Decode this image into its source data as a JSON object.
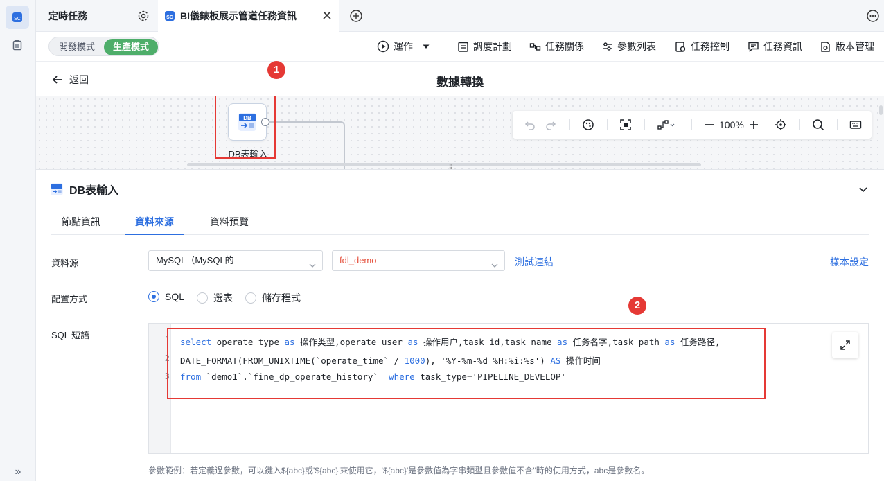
{
  "tabs": [
    {
      "label": "定時任務",
      "icon": "gear-icon"
    },
    {
      "label": "BI儀錶板展示管道任務資訊",
      "icon": "close-icon"
    }
  ],
  "mode": {
    "dev_label": "開發模式",
    "prod_label": "生產模式",
    "active": "prod"
  },
  "toolbar": {
    "run": "運作",
    "schedule": "調度計劃",
    "relation": "任務關係",
    "params": "參數列表",
    "control": "任務控制",
    "info": "任務資訊",
    "version": "版本管理"
  },
  "subhead": {
    "back": "返回",
    "title": "數據轉換"
  },
  "canvas": {
    "node_label": "DB表輸入",
    "node_icon_text": "DB",
    "badge1": "1",
    "badge2": "2",
    "zoom": "100%"
  },
  "panel": {
    "title": "DB表輸入",
    "tabs": [
      "節點資訊",
      "資料來源",
      "資料預覽"
    ],
    "active_tab": 1,
    "datasource_label": "資料源",
    "datasource_value": "MySQL（MySQL的",
    "database_value": "fdl_demo",
    "test_link": "測試連結",
    "sample_link": "樣本設定",
    "config_label": "配置方式",
    "config_options": [
      "SQL",
      "選表",
      "儲存程式"
    ],
    "config_selected": "SQL",
    "sql_label": "SQL 短語",
    "sql_lines": [
      {
        "num": "1"
      },
      {
        "num": "2"
      },
      {
        "num": "3"
      }
    ],
    "hint": "參數範例：若定義過參數，可以鍵入${abc}或'${abc}'來使用它，'${abc}'是參數值為字串類型且參數值不含''時的使用方式，abc是參數名。"
  },
  "colors": {
    "accent": "#2d6fe0",
    "prod": "#4eae6a",
    "highlight": "#e53935"
  }
}
